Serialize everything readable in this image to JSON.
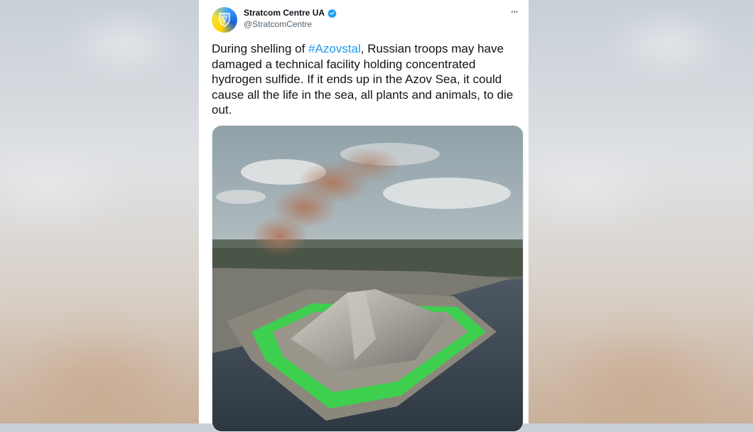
{
  "tweet": {
    "author_name": "Stratcom Centre UA",
    "author_handle": "@StratcomCentre",
    "more_label": "···",
    "text_before": "During shelling of ",
    "hashtag": "#Azovstal",
    "text_after": ", Russian troops may have damaged a technical facility holding concentrated hydrogen sulfide. If it ends up in the Azov Sea, it could cause all the life in the sea, all plants and animals, to die out."
  },
  "icons": {
    "avatar": "stratcom-logo-icon",
    "verified": "verified-badge-icon",
    "more": "more-options-icon"
  },
  "colors": {
    "link": "#1d9bf0",
    "text": "#0f1419",
    "secondary": "#536471",
    "verified": "#1d9bf0"
  }
}
